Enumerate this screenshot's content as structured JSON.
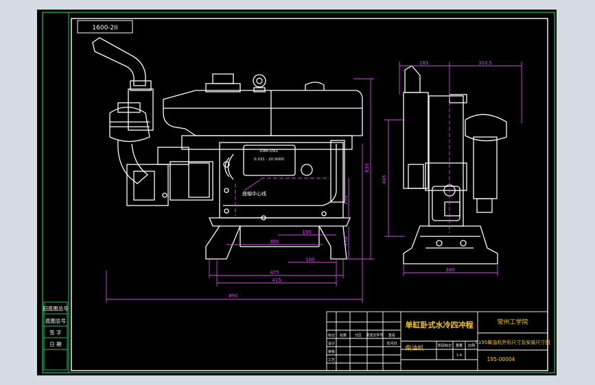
{
  "drawing": {
    "top_left_tag": "1600-2II",
    "front_view": {
      "body_plate_code": "096-091",
      "body_plate_line": "0.031 · 20 0000",
      "note_label": "曲轴中心线",
      "dims": [
        "890",
        "475",
        "415",
        "100",
        "190",
        "395",
        "110",
        "130",
        "630"
      ]
    },
    "side_view": {
      "dims_top": [
        "181",
        "310.5"
      ],
      "dim_height": "445",
      "dim_width": "340"
    },
    "left_strip": [
      "旧底图总号",
      "底图总号",
      "签  字",
      "日  期"
    ],
    "title_block": {
      "main_title": "单缸卧式水冷四冲程",
      "sub_title": "柴油机",
      "org": "常州工学院",
      "drawing_name": "S195柴油机外形尺寸及安装尺寸图",
      "drawing_no": "195-00004",
      "scale": "1:4",
      "row_labels": [
        "标记",
        "设计",
        "审核",
        "工艺"
      ],
      "col_labels": [
        "处数",
        "分区",
        "更改文件号",
        "签名",
        "年月日"
      ],
      "stage_labels": [
        "阶段标记",
        "重量",
        "比例"
      ]
    }
  },
  "colors": {
    "frame": "#22c55e",
    "line": "#ffffff",
    "dimension": "#d946ef",
    "background": "#000000"
  }
}
